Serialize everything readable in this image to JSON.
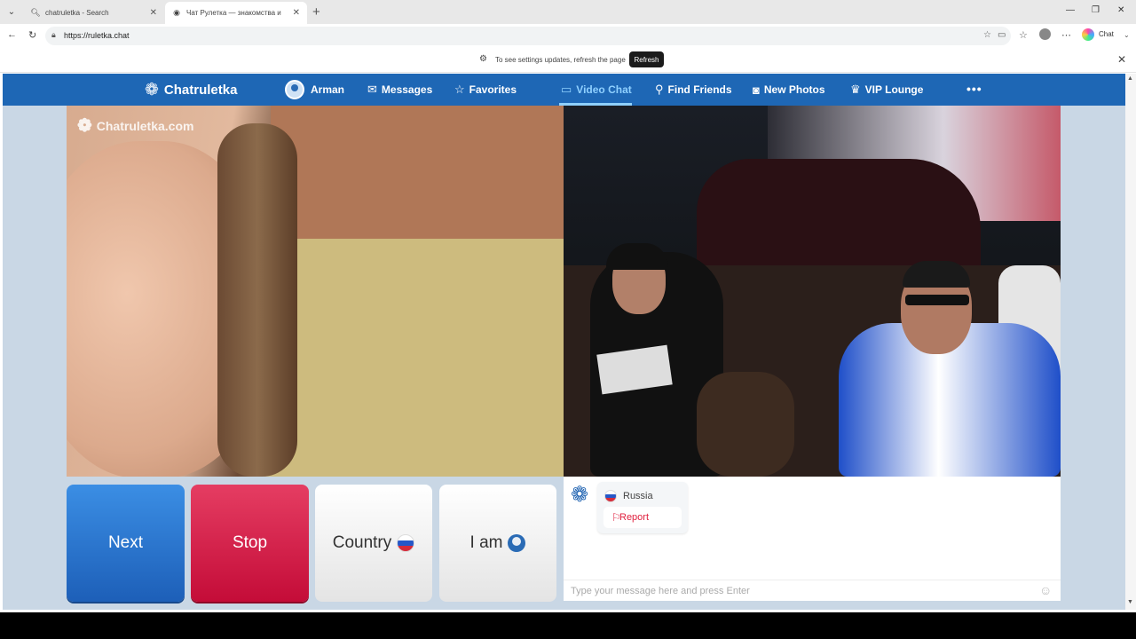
{
  "browser": {
    "tabs": [
      {
        "title": "chatruletka - Search",
        "icon": "search-icon"
      },
      {
        "title": "Чат Рулетка — знакомства и",
        "icon": "site-icon"
      }
    ],
    "url": "https://ruletka.chat",
    "chat_label": "Chat"
  },
  "infobar": {
    "message": "To see settings updates, refresh the page",
    "refresh_label": "Refresh"
  },
  "nav": {
    "brand": "Chatruletka",
    "user": "Arman",
    "items": [
      {
        "label": "Messages",
        "icon": "envelope-icon"
      },
      {
        "label": "Favorites",
        "icon": "star-icon"
      },
      {
        "label": "Video Chat",
        "icon": "video-icon"
      },
      {
        "label": "Find Friends",
        "icon": "search-icon"
      },
      {
        "label": "New Photos",
        "icon": "camera-icon"
      },
      {
        "label": "VIP Lounge",
        "icon": "crown-icon"
      }
    ],
    "active": "Video Chat",
    "more": "•••"
  },
  "video": {
    "watermark": "Chatruletka.com"
  },
  "controls": {
    "next": "Next",
    "stop": "Stop",
    "country": "Country",
    "iam": "I am"
  },
  "chat": {
    "country": "Russia",
    "report": "Report",
    "placeholder": "Type your message here and press Enter"
  },
  "colors": {
    "nav_bg": "#1e67b5",
    "next_btn": "#2a78d2",
    "stop_btn": "#d5214b",
    "report_red": "#e0213f"
  }
}
